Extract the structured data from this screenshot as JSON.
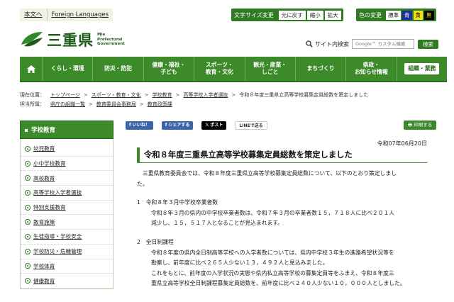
{
  "util": {
    "text_link": "本文へ",
    "foreign": "Foreign Languages"
  },
  "fontsize": {
    "label": "文字サイズ変更",
    "reset": "元に戻す",
    "small": "縮小",
    "large": "拡大"
  },
  "colors": {
    "label": "色の変更",
    "standard": "標準",
    "blue": "青",
    "yellow": "黄",
    "black": "黒",
    "accent": "#3c8a2a"
  },
  "logo": {
    "title": "三重県",
    "en1": "Mie",
    "en2": "Prefectural",
    "en3": "Government"
  },
  "search": {
    "label": "サイト内検索",
    "placeholder": "Google™ カスタム検索",
    "button": "検索"
  },
  "nav": {
    "home_icon": "home-icon",
    "items": [
      {
        "l1": "くらし・環境",
        "l2": ""
      },
      {
        "l1": "防災・防犯",
        "l2": ""
      },
      {
        "l1": "健康・福祉・",
        "l2": "子ども"
      },
      {
        "l1": "スポーツ・",
        "l2": "教育・文化"
      },
      {
        "l1": "観光・産業・",
        "l2": "しごと"
      },
      {
        "l1": "まちづくり",
        "l2": ""
      },
      {
        "l1": "県政・",
        "l2": "お知らせ情報"
      },
      {
        "l1": "組織・業務",
        "l2": ""
      }
    ]
  },
  "breadcrumb": {
    "current_label": "現在位置：",
    "current": [
      "トップページ",
      "スポーツ・教育・文化",
      "学校教育",
      "高等学校入学者選抜",
      "令和８年度三重県立高等学校募集定員総数を策定しました"
    ],
    "owner_label": "担当所属：",
    "owner": [
      "県庁の組織一覧",
      "教育委員会事務局",
      "教育政策課"
    ]
  },
  "sidebar": {
    "heading": "学校教育",
    "items": [
      "幼児教育",
      "小中学校教育",
      "高校教育",
      "高等学校入学者選抜",
      "特別支援教育",
      "教育施策",
      "生徒指導・学校安全",
      "学校防災・危機管理",
      "学校体育",
      "健康教育"
    ]
  },
  "share": {
    "like": "いいね！",
    "fb_share": "シェアする",
    "x_post": "ポスト",
    "line": "LINEで送る",
    "print": "印刷する"
  },
  "article": {
    "date": "令和07年06月20日",
    "title": "令和８年度三重県立高等学校募集定員総数を策定しました",
    "intro_1": "三重県教育委員会では、令和８年度三重県立高等学校募集定員総数について、以下のとおり策定しまし",
    "intro_2": "た。",
    "s1_head": "1　令和８年３月中学校卒業者数",
    "s1_p1": "令和８年３月の県内の中学校卒業者数は、令和７年３月の卒業者数１５，７１８人に比べ２０１人",
    "s1_p2": "減少し、１５，５１７人となることが見込まれます。",
    "s2_head": "2　全日制課程",
    "s2_p1": "令和８年度の県内全日制高等学校への入学者数については、県内中学校３年生の進路希望状況等を",
    "s2_p2": "勘案し、前年度に比べ２６５人少ない１３，４９２人と見込みました。",
    "s2_p3": "これをもとに、前年度の入学状況の実態や県内私立高等学校の募集定員等をふまえ、令和８年度三",
    "s2_p4": "重県立高等学校全日制課程募集定員総数を、前年度に比べ２４０人少ない１０，０００人としました。"
  }
}
